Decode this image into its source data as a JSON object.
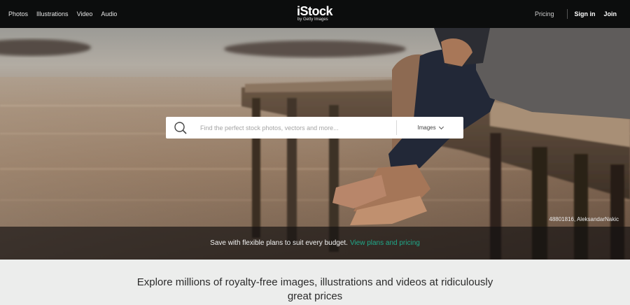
{
  "nav": {
    "links": [
      "Photos",
      "Illustrations",
      "Video",
      "Audio"
    ],
    "pricing": "Pricing",
    "sign_in": "Sign in",
    "join": "Join"
  },
  "logo": {
    "brand": "iStock",
    "sub": "by Getty Images"
  },
  "search": {
    "placeholder": "Find the perfect stock photos, vectors and more...",
    "media_type": "Images",
    "icon": "search-icon"
  },
  "hero": {
    "credit": "48801816, AleksandarNakic"
  },
  "promo": {
    "text": "Save with flexible plans to suit every budget.",
    "link": "View plans and pricing",
    "link_color": "#1fa98a"
  },
  "explore": {
    "headline": "Explore millions of royalty-free images, illustrations and videos at ridiculously great prices"
  },
  "colors": {
    "nav_bg": "#0c0d0d",
    "accent": "#1fa98a",
    "body_bg": "#ecedec"
  }
}
